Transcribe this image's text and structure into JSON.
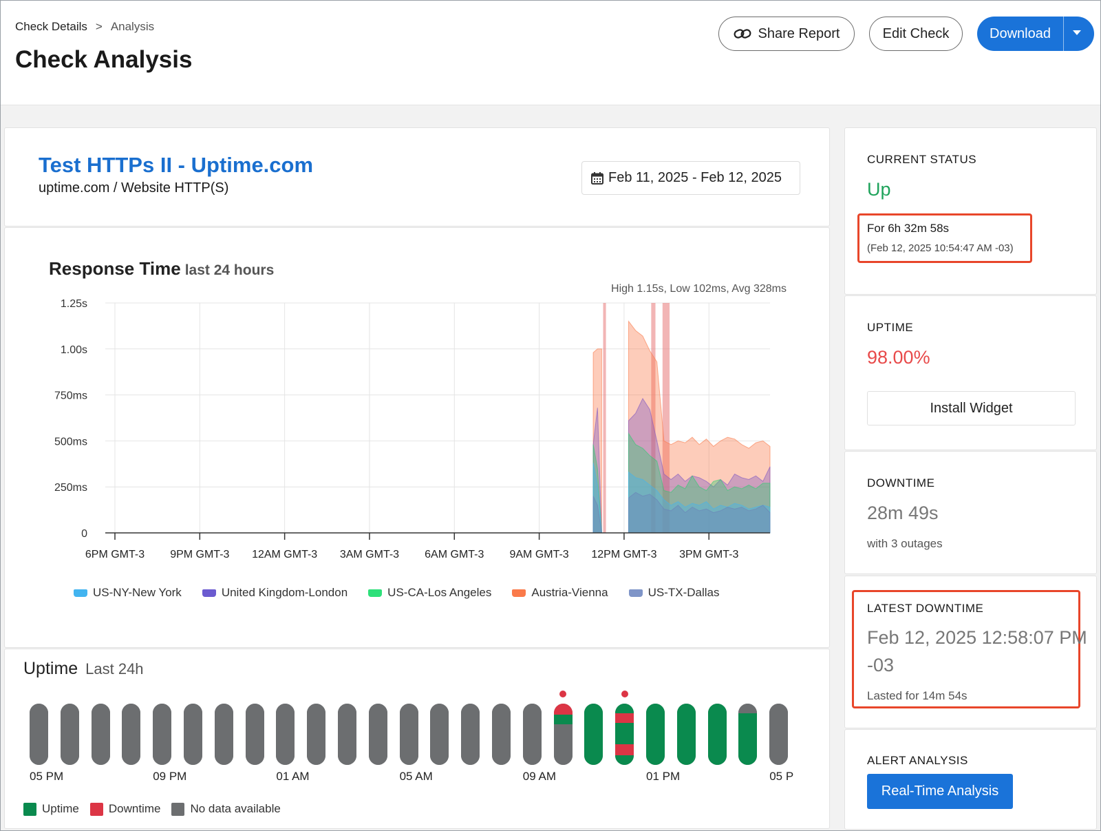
{
  "header": {
    "breadcrumb": [
      "Check Details",
      ">",
      "Analysis"
    ],
    "title": "Check Analysis",
    "share_label": "Share Report",
    "edit_label": "Edit Check",
    "download_label": "Download"
  },
  "check": {
    "name": "Test HTTPs II - Uptime.com",
    "subtitle": "uptime.com / Website HTTP(S)",
    "date_range": "Feb 11, 2025 - Feb 12, 2025"
  },
  "response_chart": {
    "title": "Response Time",
    "title_suffix": "last 24 hours",
    "stats": "High 1.15s, Low 102ms, Avg 328ms"
  },
  "chart_data": {
    "type": "area",
    "title": "Response Time last 24 hours",
    "xlabel": "",
    "ylabel": "",
    "y_ticks": [
      "0",
      "250ms",
      "500ms",
      "750ms",
      "1.00s",
      "1.25s"
    ],
    "y_tick_values": [
      0,
      250,
      500,
      750,
      1000,
      1250
    ],
    "ylim": [
      0,
      1250
    ],
    "x_ticks": [
      "6PM GMT-3",
      "9PM GMT-3",
      "12AM GMT-3",
      "3AM GMT-3",
      "6AM GMT-3",
      "9AM GMT-3",
      "12PM GMT-3",
      "3PM GMT-3"
    ],
    "x_tick_hours": [
      0,
      3,
      6,
      9,
      12,
      15,
      18,
      21
    ],
    "xlim_hours": [
      0,
      23.5
    ],
    "grid": true,
    "legend_position": "bottom",
    "downtime_bands_hours": [
      [
        17.6,
        17.7
      ],
      [
        19.3,
        19.45
      ],
      [
        19.7,
        19.95
      ]
    ],
    "x_hours": [
      17.25,
      17.4,
      17.55,
      18.5,
      18.75,
      19.0,
      19.25,
      19.5,
      19.75,
      20.0,
      20.25,
      20.5,
      20.75,
      21.0,
      21.25,
      21.5,
      21.75,
      22.0,
      22.25,
      22.5,
      22.75,
      23.0,
      23.25,
      23.5
    ],
    "series": [
      {
        "name": "Austria-Vienna",
        "color": "#fa7a4a",
        "values": [
          980,
          1000,
          1000,
          1150,
          1100,
          1070,
          990,
          930,
          500,
          480,
          500,
          490,
          520,
          480,
          510,
          470,
          500,
          520,
          510,
          480,
          460,
          490,
          500,
          470
        ]
      },
      {
        "name": "United Kingdom-London",
        "color": "#7e57c2",
        "values": [
          480,
          680,
          0,
          610,
          650,
          730,
          670,
          500,
          320,
          290,
          320,
          280,
          310,
          300,
          280,
          250,
          290,
          260,
          320,
          300,
          290,
          310,
          280,
          360
        ]
      },
      {
        "name": "US-CA-Los Angeles",
        "color": "#2ecc71",
        "values": [
          480,
          350,
          0,
          540,
          480,
          460,
          420,
          390,
          230,
          220,
          260,
          240,
          310,
          250,
          230,
          280,
          290,
          230,
          250,
          240,
          260,
          240,
          270,
          270
        ]
      },
      {
        "name": "US-NY-New York",
        "color": "#42b4f0",
        "values": [
          380,
          260,
          0,
          330,
          300,
          290,
          260,
          230,
          180,
          150,
          170,
          140,
          160,
          150,
          170,
          130,
          150,
          140,
          160,
          150,
          130,
          140,
          150,
          140
        ]
      },
      {
        "name": "US-TX-Dallas",
        "color": "#6a80b8",
        "values": [
          200,
          150,
          0,
          190,
          220,
          200,
          210,
          180,
          130,
          120,
          150,
          110,
          140,
          120,
          130,
          110,
          120,
          140,
          130,
          140,
          120,
          130,
          150,
          110
        ]
      }
    ]
  },
  "legend": [
    {
      "label": "US-NY-New York",
      "color": "#42b4f0"
    },
    {
      "label": "United Kingdom-London",
      "color": "#6b5bd0"
    },
    {
      "label": "US-CA-Los Angeles",
      "color": "#2ee07a"
    },
    {
      "label": "Austria-Vienna",
      "color": "#fa7a4a"
    },
    {
      "label": "US-TX-Dallas",
      "color": "#7f95c8"
    }
  ],
  "uptime": {
    "title": "Uptime",
    "title_suffix": "Last 24h",
    "tick_labels": [
      "05 PM",
      "09 PM",
      "01 AM",
      "05 AM",
      "09 AM",
      "01 PM",
      "05 P"
    ],
    "tick_bar_index": [
      0,
      4,
      8,
      12,
      16,
      20,
      24
    ],
    "bars": [
      "nodata",
      "nodata",
      "nodata",
      "nodata",
      "nodata",
      "nodata",
      "nodata",
      "nodata",
      "nodata",
      "nodata",
      "nodata",
      "nodata",
      "nodata",
      "nodata",
      "nodata",
      "nodata",
      "nodata",
      "mixed-a",
      "uptime",
      "mixed-b",
      "uptime",
      "uptime",
      "uptime",
      "mixed-c",
      "nodata"
    ],
    "outage_dot_bars": [
      17,
      19
    ],
    "legend": [
      {
        "label": "Uptime",
        "color": "#0a8a4e"
      },
      {
        "label": "Downtime",
        "color": "#dc3545"
      },
      {
        "label": "No data available",
        "color": "#6c6e70"
      }
    ]
  },
  "status": {
    "label": "CURRENT STATUS",
    "value": "Up",
    "duration": "For 6h 32m 58s",
    "since": "(Feb 12, 2025 10:54:47 AM -03)"
  },
  "uptime_card": {
    "label": "UPTIME",
    "value": "98.00%",
    "widget_label": "Install Widget"
  },
  "downtime_card": {
    "label": "DOWNTIME",
    "value": "28m 49s",
    "sub": "with 3 outages"
  },
  "latest_downtime": {
    "label": "LATEST DOWNTIME",
    "value_line1": "Feb 12, 2025 12:58:07 PM",
    "value_line2": "-03",
    "sub": "Lasted for 14m 54s"
  },
  "alert_analysis": {
    "label": "ALERT ANALYSIS",
    "button_label": "Real-Time Analysis"
  },
  "colors": {
    "accent": "#1a73d9",
    "up": "#1fa35b",
    "uptime_pct": "#e84a4a",
    "highlight": "#e8462a"
  }
}
